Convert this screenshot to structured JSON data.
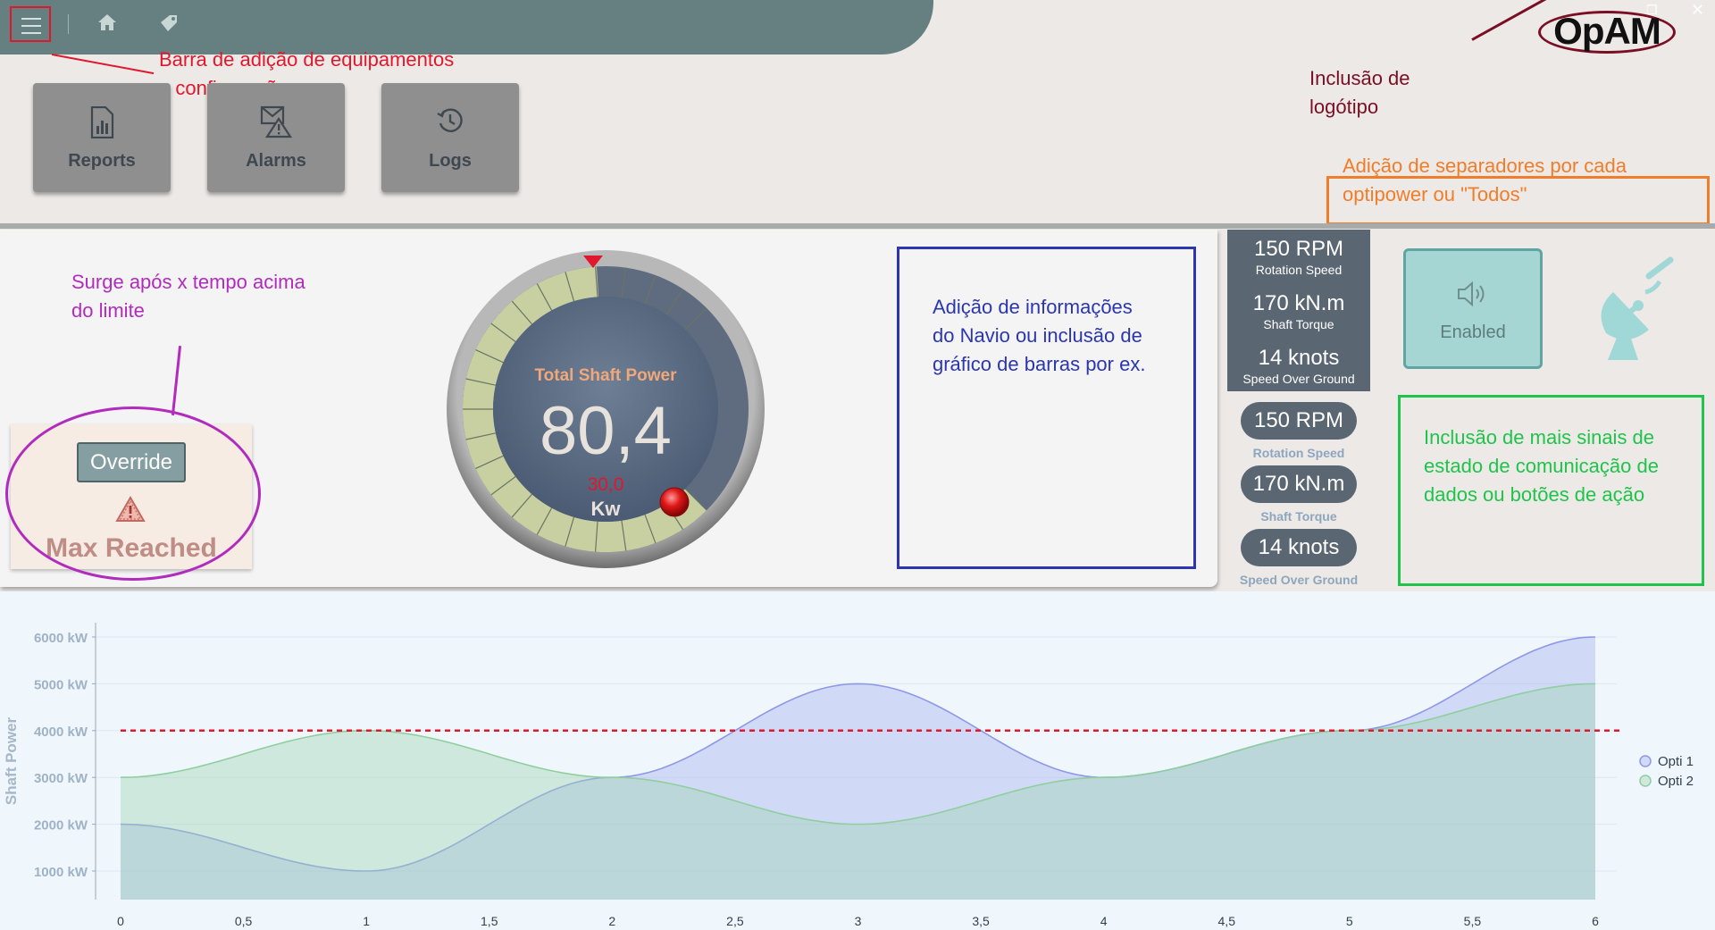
{
  "nav": {
    "menu_icon": "hamburger-menu-icon",
    "home_icon": "home-icon",
    "tag_icon": "bookmark-tag-icon"
  },
  "tiles": [
    {
      "label": "Reports",
      "icon": "report-chart-icon"
    },
    {
      "label": "Alarms",
      "icon": "alarm-warning-icon"
    },
    {
      "label": "Logs",
      "icon": "history-clock-icon"
    }
  ],
  "annotations": {
    "menu_bar_note_1": "Barra de adição de equipamentos",
    "menu_bar_note_2": "e configurações",
    "logo_note_1": "Inclusão de",
    "logo_note_2": "logótipo",
    "tabs_note_1": "Adição de separadores por cada",
    "tabs_note_2": "optipower ou \"Todos\"",
    "override_note_1": "Surge após x tempo acima",
    "override_note_2": "do limite",
    "ship_note_1": "Adição de informações",
    "ship_note_2": "do Navio ou inclusão de",
    "ship_note_3": "gráfico de barras por ex.",
    "signals_note_1": "Inclusão de mais sinais de",
    "signals_note_2": "estado de comunicação de",
    "signals_note_3": "dados ou botões de ação"
  },
  "logo": "OpAM",
  "gauge": {
    "title": "Total Shaft Power",
    "value": "80,4",
    "limit": "30,0",
    "unit": "Kw",
    "fill_fraction": 0.82
  },
  "override": {
    "button_label": "Override",
    "status": "Max Reached"
  },
  "dark_panel": [
    {
      "value": "150 RPM",
      "label": "Rotation Speed"
    },
    {
      "value": "170 kN.m",
      "label": "Shaft Torque"
    },
    {
      "value": "14 knots",
      "label": "Speed Over Ground"
    }
  ],
  "pills": [
    {
      "value": "150 RPM",
      "label": "Rotation Speed"
    },
    {
      "value": "170 kN.m",
      "label": "Shaft Torque"
    },
    {
      "value": "14 knots",
      "label": "Speed Over Ground"
    }
  ],
  "sound_button": {
    "label": "Enabled",
    "icon": "speaker-icon"
  },
  "comm_icon": "satellite-dish-icon",
  "colors": {
    "accent_red": "#e0182d",
    "opti1": "#8f98e6",
    "opti2": "#8fcf9e",
    "limit_line": "#e0182d"
  },
  "chart_data": {
    "type": "area",
    "ylabel": "Shaft Power",
    "xlim": [
      0,
      6
    ],
    "ylim": [
      500,
      6500
    ],
    "x_ticks": [
      "0",
      "0,5",
      "1",
      "1,5",
      "2",
      "2,5",
      "3",
      "3,5",
      "4",
      "4,5",
      "5",
      "5,5",
      "6"
    ],
    "y_ticks": [
      "1000 kW",
      "2000 kW",
      "3000 kW",
      "4000 kW",
      "5000 kW",
      "6000 kW"
    ],
    "threshold": 4000,
    "x": [
      0,
      1,
      2,
      3,
      4,
      5,
      6
    ],
    "series": [
      {
        "name": "Opti 1",
        "values": [
          2000,
          1000,
          3000,
          5000,
          3000,
          4000,
          6000
        ]
      },
      {
        "name": "Opti 2",
        "values": [
          3000,
          4000,
          3000,
          2000,
          3000,
          4000,
          5000
        ]
      }
    ],
    "legend": "right",
    "grid": true
  }
}
